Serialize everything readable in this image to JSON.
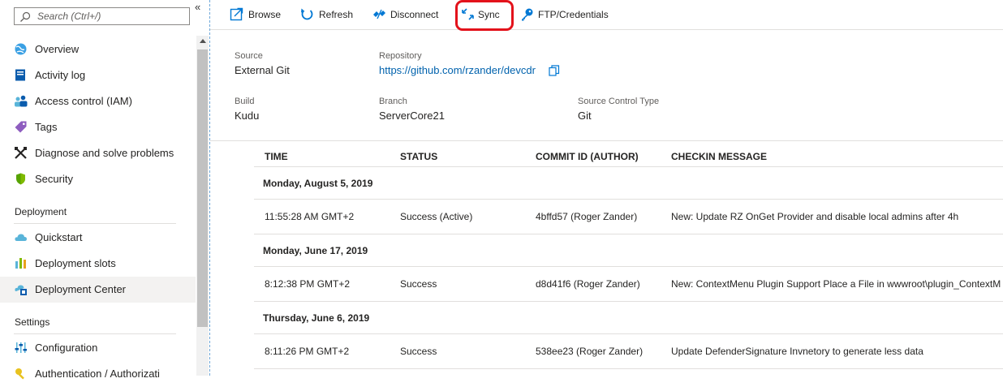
{
  "search": {
    "placeholder": "Search (Ctrl+/)"
  },
  "sidebar": {
    "collapse_glyph": "«",
    "items_top": [
      {
        "label": "Overview",
        "icon": "globe-icon"
      },
      {
        "label": "Activity log",
        "icon": "activity-log-icon"
      },
      {
        "label": "Access control (IAM)",
        "icon": "people-icon"
      },
      {
        "label": "Tags",
        "icon": "tag-icon"
      },
      {
        "label": "Diagnose and solve problems",
        "icon": "wrench-icon"
      },
      {
        "label": "Security",
        "icon": "shield-icon"
      }
    ],
    "deployment_header": "Deployment",
    "deployment_items": [
      {
        "label": "Quickstart",
        "icon": "cloud-icon"
      },
      {
        "label": "Deployment slots",
        "icon": "slots-icon"
      },
      {
        "label": "Deployment Center",
        "icon": "deployment-center-icon",
        "active": true
      }
    ],
    "settings_header": "Settings",
    "settings_items": [
      {
        "label": "Configuration",
        "icon": "sliders-icon"
      },
      {
        "label": "Authentication / Authorizati",
        "icon": "key-icon"
      }
    ]
  },
  "toolbar": {
    "browse": "Browse",
    "refresh": "Refresh",
    "disconnect": "Disconnect",
    "sync": "Sync",
    "ftp": "FTP/Credentials"
  },
  "properties": {
    "source_label": "Source",
    "source_value": "External Git",
    "repository_label": "Repository",
    "repository_value": "https://github.com/rzander/devcdr",
    "build_label": "Build",
    "build_value": "Kudu",
    "branch_label": "Branch",
    "branch_value": "ServerCore21",
    "sct_label": "Source Control Type",
    "sct_value": "Git"
  },
  "table": {
    "headers": {
      "time": "TIME",
      "status": "STATUS",
      "commit": "COMMIT ID (AUTHOR)",
      "message": "CHECKIN MESSAGE"
    },
    "groups": [
      {
        "date": "Monday, August 5, 2019",
        "row": {
          "time": "11:55:28 AM GMT+2",
          "status": "Success (Active)",
          "commit": "4bffd57 (Roger Zander)",
          "message": "New: Update RZ OnGet Provider and disable local admins after 4h"
        }
      },
      {
        "date": "Monday, June 17, 2019",
        "row": {
          "time": "8:12:38 PM GMT+2",
          "status": "Success",
          "commit": "d8d41f6 (Roger Zander)",
          "message": "New: ContextMenu Plugin Support Place a File in wwwroot\\plugin_ContextM"
        }
      },
      {
        "date": "Thursday, June 6, 2019",
        "row": {
          "time": "8:11:26 PM GMT+2",
          "status": "Success",
          "commit": "538ee23 (Roger Zander)",
          "message": "Update DefenderSignature Invnetory to generate less data"
        }
      }
    ]
  },
  "colors": {
    "accent": "#0078d4",
    "link": "#0062ad",
    "highlight": "#e3121b"
  }
}
